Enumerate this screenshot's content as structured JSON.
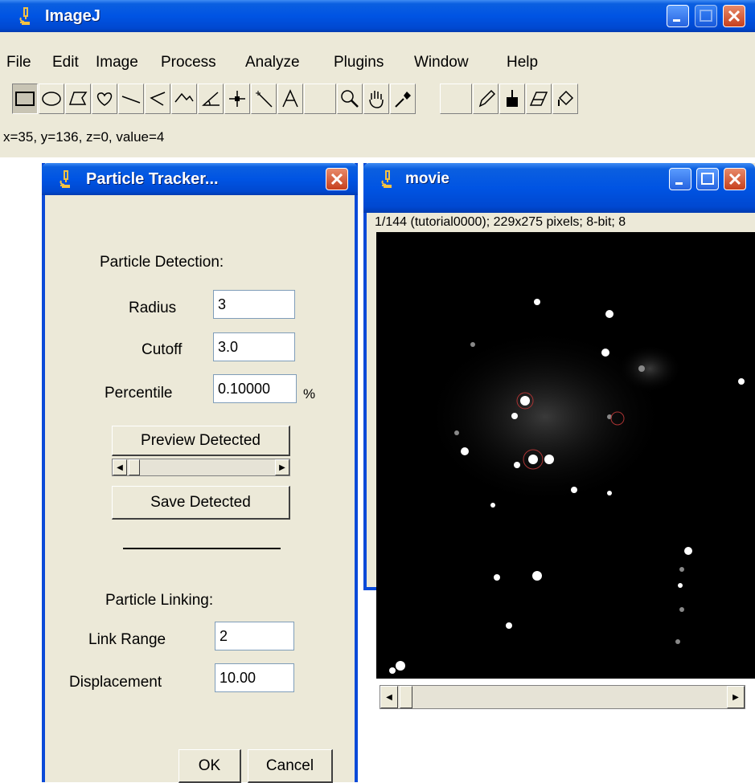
{
  "imagej": {
    "title": "ImageJ",
    "menus": [
      "File",
      "Edit",
      "Image",
      "Process",
      "Analyze",
      "Plugins",
      "Window",
      "Help"
    ],
    "tools": [
      "rectangle-tool-icon",
      "oval-tool-icon",
      "polygon-tool-icon",
      "freehand-tool-icon",
      "straight-line-tool-icon",
      "segmented-line-tool-icon",
      "freehand-line-tool-icon",
      "angle-tool-icon",
      "point-tool-icon",
      "wand-tool-icon",
      "text-tool-icon",
      "magnifier-tool-icon",
      "hand-tool-icon",
      "color-picker-icon",
      "pencil-tool-icon",
      "paintbrush-tool-icon",
      "eraser-tool-icon",
      "flood-fill-tool-icon"
    ],
    "status": "x=35, y=136, z=0, value=4"
  },
  "tracker": {
    "title": "Particle Tracker...",
    "detection_heading": "Particle Detection:",
    "radius_label": "Radius",
    "radius_value": "3",
    "cutoff_label": "Cutoff",
    "cutoff_value": "3.0",
    "percentile_label": "Percentile",
    "percentile_value": "0.10000",
    "percent_sign": "%",
    "preview_button": "Preview Detected",
    "save_button": "Save Detected",
    "linking_heading": "Particle Linking:",
    "link_range_label": "Link Range",
    "link_range_value": "2",
    "displacement_label": "Displacement",
    "displacement_value": "10.00",
    "ok_button": "OK",
    "cancel_button": "Cancel"
  },
  "movie": {
    "title": "movie",
    "info": "1/144 (tutorial0000); 229x275 pixels; 8-bit; 8"
  },
  "colors": {
    "title_bar": "#0054e3",
    "window_bg": "#ece9d8",
    "close_button": "#c6401e"
  }
}
